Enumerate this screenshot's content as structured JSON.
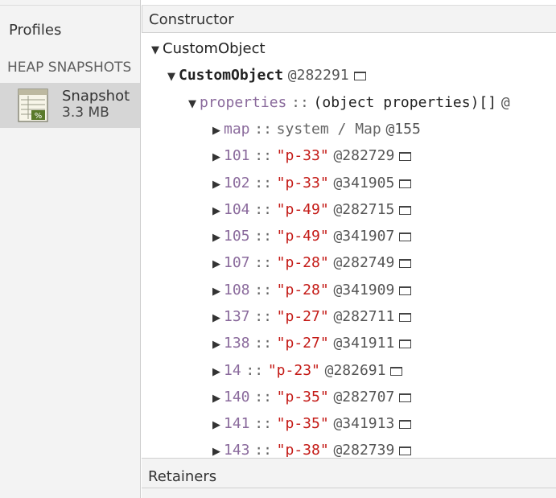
{
  "sidebar": {
    "title": "Profiles",
    "section": "HEAP SNAPSHOTS",
    "snapshot": {
      "name": "Snapshot",
      "size": "3.3 MB",
      "icon": "snapshot-icon"
    }
  },
  "main": {
    "column_header": "Constructor",
    "retainers_header": "Retainers",
    "tree": [
      {
        "indent": 12,
        "expanded": true,
        "kind": "plain",
        "name": "CustomObject"
      },
      {
        "indent": 32,
        "expanded": true,
        "kind": "bold",
        "name": "CustomObject",
        "id": "@282291",
        "box": true
      },
      {
        "indent": 58,
        "expanded": true,
        "kind": "props",
        "name": "properties",
        "sep": "::",
        "value": "(object properties)[]",
        "id": "@"
      },
      {
        "indent": 88,
        "expanded": false,
        "kind": "map",
        "name": "map",
        "sep": "::",
        "value": "system / Map",
        "id": "@155"
      },
      {
        "indent": 88,
        "expanded": false,
        "kind": "str",
        "name": "101",
        "sep": "::",
        "value": "\"p-33\"",
        "id": "@282729",
        "box": true
      },
      {
        "indent": 88,
        "expanded": false,
        "kind": "str",
        "name": "102",
        "sep": "::",
        "value": "\"p-33\"",
        "id": "@341905",
        "box": true
      },
      {
        "indent": 88,
        "expanded": false,
        "kind": "str",
        "name": "104",
        "sep": "::",
        "value": "\"p-49\"",
        "id": "@282715",
        "box": true
      },
      {
        "indent": 88,
        "expanded": false,
        "kind": "str",
        "name": "105",
        "sep": "::",
        "value": "\"p-49\"",
        "id": "@341907",
        "box": true
      },
      {
        "indent": 88,
        "expanded": false,
        "kind": "str",
        "name": "107",
        "sep": "::",
        "value": "\"p-28\"",
        "id": "@282749",
        "box": true
      },
      {
        "indent": 88,
        "expanded": false,
        "kind": "str",
        "name": "108",
        "sep": "::",
        "value": "\"p-28\"",
        "id": "@341909",
        "box": true
      },
      {
        "indent": 88,
        "expanded": false,
        "kind": "str",
        "name": "137",
        "sep": "::",
        "value": "\"p-27\"",
        "id": "@282711",
        "box": true
      },
      {
        "indent": 88,
        "expanded": false,
        "kind": "str",
        "name": "138",
        "sep": "::",
        "value": "\"p-27\"",
        "id": "@341911",
        "box": true
      },
      {
        "indent": 88,
        "expanded": false,
        "kind": "str",
        "name": "14",
        "sep": "::",
        "value": "\"p-23\"",
        "id": "@282691",
        "box": true
      },
      {
        "indent": 88,
        "expanded": false,
        "kind": "str",
        "name": "140",
        "sep": "::",
        "value": "\"p-35\"",
        "id": "@282707",
        "box": true
      },
      {
        "indent": 88,
        "expanded": false,
        "kind": "str",
        "name": "141",
        "sep": "::",
        "value": "\"p-35\"",
        "id": "@341913",
        "box": true
      },
      {
        "indent": 88,
        "expanded": false,
        "kind": "str",
        "name": "143",
        "sep": "::",
        "value": "\"p-38\"",
        "id": "@282739",
        "box": true
      }
    ]
  },
  "colors": {
    "string": "#c41a16",
    "property": "#8a6a9c",
    "selected_bg": "#d6d6d6"
  }
}
